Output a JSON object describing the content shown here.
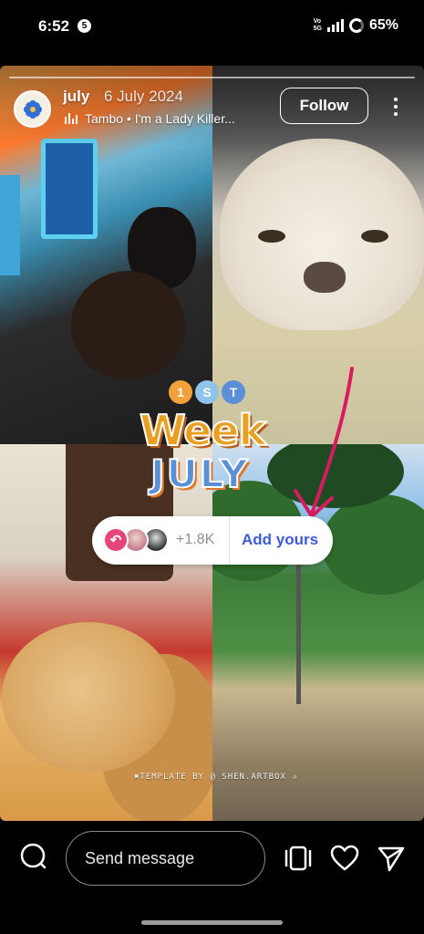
{
  "status_bar": {
    "time": "6:52",
    "notification_count": "5",
    "network_top": "Vo",
    "network_bottom": "5G",
    "network_type": "5G",
    "battery": "65%"
  },
  "story": {
    "username": "july",
    "date": "6 July 2024",
    "music": "Tambo • I'm a Lady Killer...",
    "follow_label": "Follow",
    "sticker": {
      "dots": [
        "1",
        "S",
        "T"
      ],
      "week": "Week",
      "july": "JULY"
    },
    "add_yours": {
      "count": "+1.8K",
      "label": "Add yours"
    },
    "credit": "✖TEMPLATE BY @ SHEN.ARTBOX ✰"
  },
  "bottom_bar": {
    "message_placeholder": "Send message"
  },
  "icons": [
    "camera-icon",
    "reels-icon",
    "heart-icon",
    "send-icon",
    "more-vertical-icon",
    "music-bars-icon"
  ],
  "colors": {
    "accent_blue": "#3d5ad8",
    "sticker_orange": "#e9a021",
    "sticker_blue": "#5b8fd8",
    "arrow_pink": "#d81b60"
  }
}
